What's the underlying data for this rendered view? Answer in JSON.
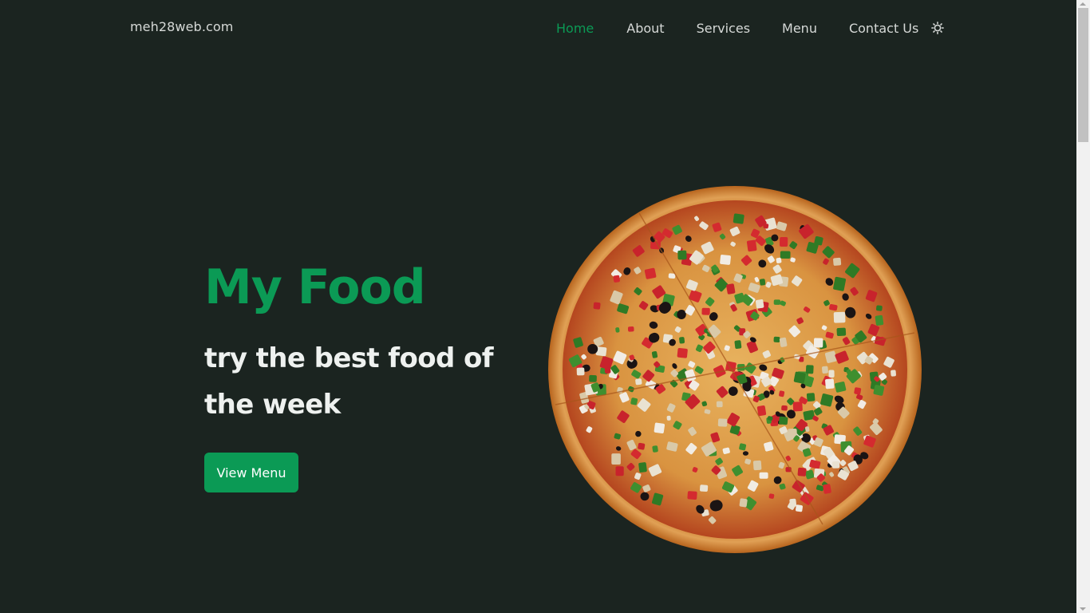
{
  "navbar": {
    "brand": "meh28web.com",
    "links": [
      {
        "label": "Home",
        "active": true
      },
      {
        "label": "About",
        "active": false
      },
      {
        "label": "Services",
        "active": false
      },
      {
        "label": "Menu",
        "active": false
      },
      {
        "label": "Contact Us",
        "active": false
      }
    ],
    "theme_toggle_icon": "sun-icon"
  },
  "hero": {
    "title": "My Food",
    "subtitle": "try the best food of the week",
    "cta_label": "View Menu",
    "image": "pizza-image"
  },
  "colors": {
    "background": "#1b2420",
    "accent": "#0b9a55",
    "text_light": "#eef1ef",
    "nav_text": "#d6d9d7"
  }
}
